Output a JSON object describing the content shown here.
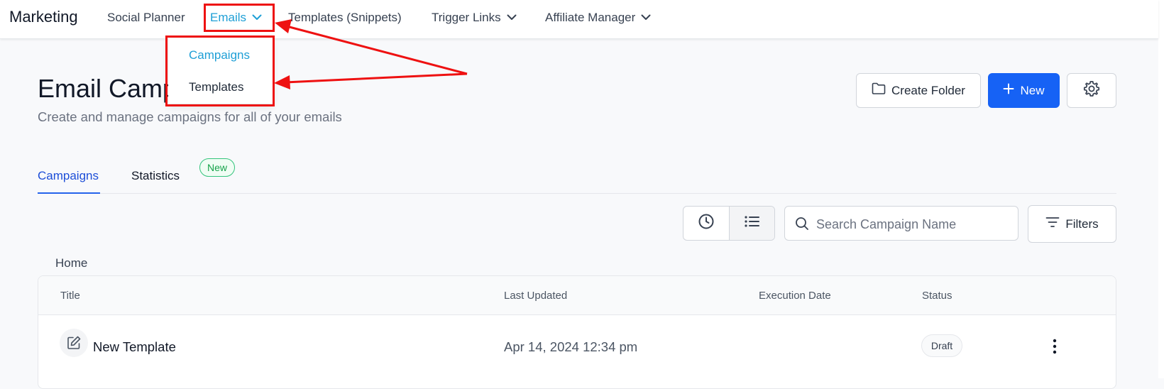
{
  "app": {
    "title": "Marketing"
  },
  "nav": {
    "social_planner": "Social Planner",
    "emails": "Emails",
    "templates_snippets": "Templates (Snippets)",
    "trigger_links": "Trigger Links",
    "affiliate_manager": "Affiliate Manager"
  },
  "emails_dropdown": {
    "items": [
      "Campaigns",
      "Templates"
    ]
  },
  "page": {
    "title": "Email Campaigns",
    "subtitle": "Create and manage campaigns for all of your emails"
  },
  "actions": {
    "create_folder": "Create Folder",
    "new": "New",
    "settings_icon": "gear-icon"
  },
  "tabs": [
    {
      "label": "Campaigns",
      "active": true
    },
    {
      "label": "Statistics",
      "badge": "New"
    }
  ],
  "toolbar": {
    "history_icon": "clock-icon",
    "list_icon": "list-icon",
    "search_placeholder": "Search Campaign Name",
    "filters": "Filters"
  },
  "breadcrumb": "Home",
  "table": {
    "headers": [
      "Title",
      "Last Updated",
      "Execution Date",
      "Status"
    ],
    "rows": [
      {
        "title": "New Template",
        "last_updated": "Apr 14, 2024 12:34 pm",
        "execution_date": "",
        "status": "Draft"
      }
    ]
  },
  "colors": {
    "accent": "#1662f5",
    "nav_active": "#1e9fd6",
    "annotation": "#ee1111",
    "badge_green": "#16a34a"
  }
}
